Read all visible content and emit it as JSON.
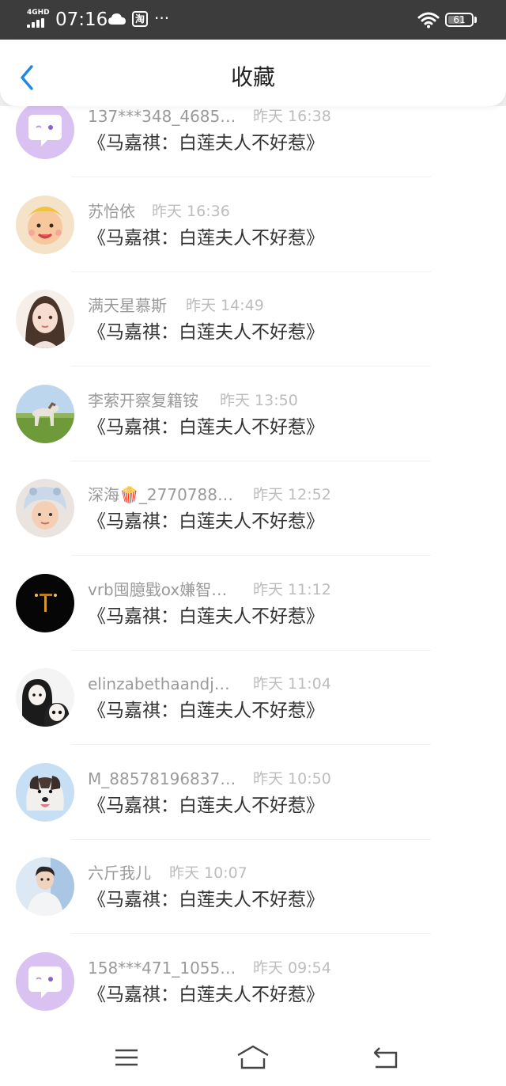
{
  "status_bar": {
    "network": "4GHD",
    "time": "07:16",
    "more": "···",
    "taobao_glyph": "淘",
    "battery": "61",
    "icons": [
      "signal-icon",
      "cloud-icon",
      "taobao-icon",
      "wifi-icon",
      "battery-icon"
    ]
  },
  "header": {
    "title": "收藏",
    "back_icon": "chevron-left-icon",
    "accent_color": "#1e88e5"
  },
  "items": [
    {
      "name": "137***348_4685…",
      "time": "昨天 16:38",
      "content": "《马嘉祺：白莲夫人不好惹》",
      "avatar": "default-chat-avatar"
    },
    {
      "name": "苏怡依",
      "time": "昨天 16:36",
      "content": "《马嘉祺：白莲夫人不好惹》",
      "avatar": "child-photo-avatar"
    },
    {
      "name": "满天星慕斯",
      "time": "昨天 14:49",
      "content": "《马嘉祺：白莲夫人不好惹》",
      "avatar": "illustrated-girl-avatar"
    },
    {
      "name": "李萦开察复籍铵",
      "time": "昨天 13:50",
      "content": "《马嘉祺：白莲夫人不好惹》",
      "avatar": "horse-landscape-avatar"
    },
    {
      "name": "深海🍿_2770788…",
      "time": "昨天 12:52",
      "content": "《马嘉祺：白莲夫人不好惹》",
      "avatar": "child-costume-avatar"
    },
    {
      "name": "vrb囤臆戥ox嫌智…",
      "time": "昨天 11:12",
      "content": "《马嘉祺：白莲夫人不好惹》",
      "avatar": "dark-lights-avatar"
    },
    {
      "name": "elinzabethaandj…",
      "time": "昨天 11:04",
      "content": "《马嘉祺：白莲夫人不好惹》",
      "avatar": "anime-characters-avatar"
    },
    {
      "name": "M_88578196837…",
      "time": "昨天 10:50",
      "content": "《马嘉祺：白莲夫人不好惹》",
      "avatar": "dog-photo-avatar"
    },
    {
      "name": "六斤我儿",
      "time": "昨天 10:07",
      "content": "《马嘉祺：白莲夫人不好惹》",
      "avatar": "person-photo-avatar"
    },
    {
      "name": "158***471_1055…",
      "time": "昨天 09:54",
      "content": "《马嘉祺：白莲夫人不好惹》",
      "avatar": "default-chat-avatar"
    }
  ],
  "bottom_nav": {
    "icons": [
      "menu-icon",
      "home-icon",
      "back-icon"
    ]
  }
}
